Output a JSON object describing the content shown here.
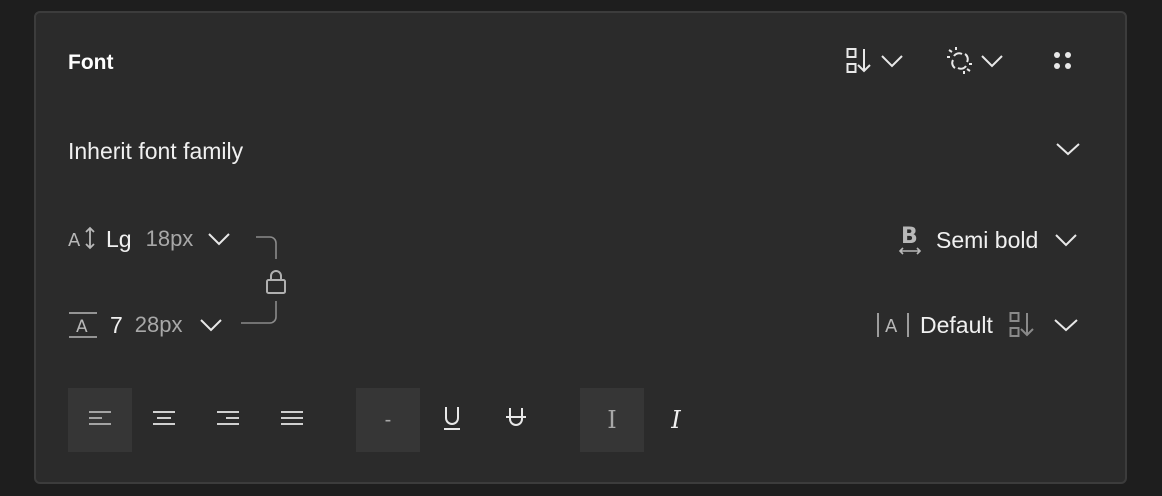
{
  "panel": {
    "title": "Font"
  },
  "header_actions": {
    "sort_icon": "sort-order-icon",
    "unlink_icon": "unlink-icon",
    "more_icon": "drag-handle-icon"
  },
  "font_family": {
    "value": "Inherit font family"
  },
  "font_size": {
    "icon": "font-size-icon",
    "token": "Lg",
    "px": "18px"
  },
  "line_height": {
    "icon": "line-height-icon",
    "token": "7",
    "px": "28px"
  },
  "font_weight": {
    "icon": "font-weight-icon",
    "value": "Semi bold"
  },
  "letter_spacing": {
    "icon": "letter-spacing-icon",
    "value": "Default"
  },
  "text_align": {
    "options": [
      "align-left",
      "align-center",
      "align-right",
      "align-justify"
    ],
    "selected": "align-left"
  },
  "decoration": {
    "options": [
      "none",
      "underline",
      "strikethrough"
    ],
    "selected": "none",
    "none_glyph": "-"
  },
  "font_style": {
    "options": [
      "normal",
      "italic"
    ],
    "selected": "normal",
    "normal_glyph": "I",
    "italic_glyph": "I"
  },
  "colors": {
    "background": "#2b2b2b",
    "border": "#3c3c3c",
    "text": "#f0f0f0",
    "muted": "#a8a8a8",
    "active_segment": "#363636"
  }
}
